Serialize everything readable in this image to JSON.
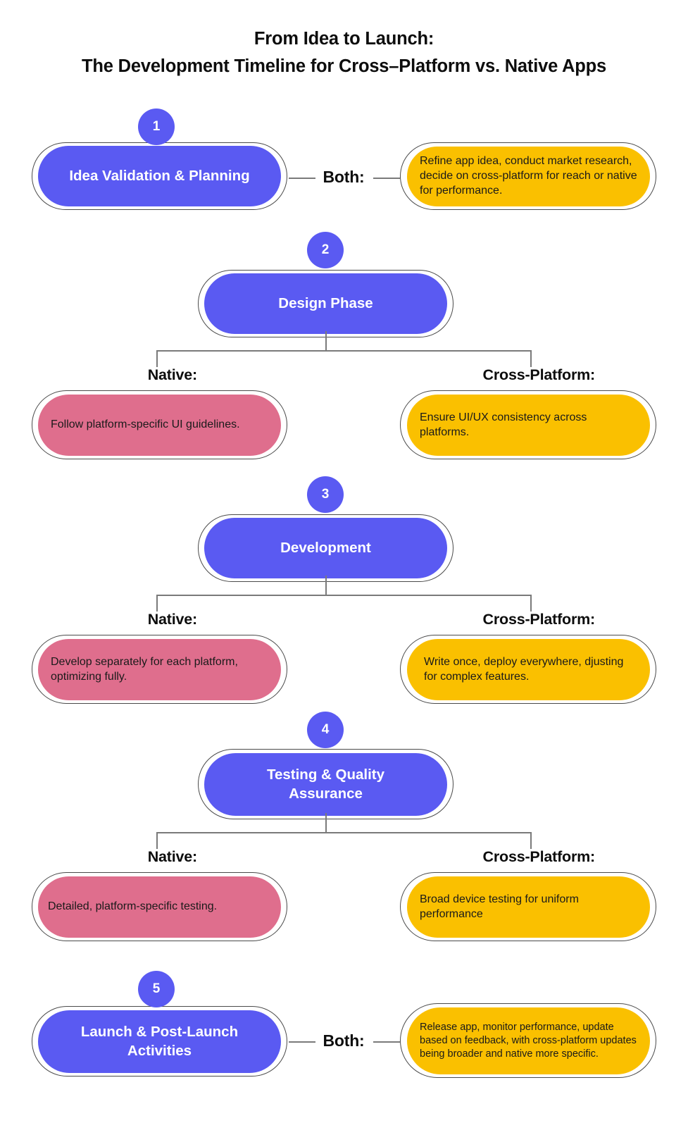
{
  "title": {
    "line1": "From Idea to Launch:",
    "line2": "The Development Timeline for Cross–Platform vs. Native Apps"
  },
  "colors": {
    "blue": "#5a5af2",
    "yellow": "#fac000",
    "pink": "#df6e8d",
    "outline": "#4a4a4a",
    "connector": "#7a7a7a",
    "text_dark": "#0d0d0d",
    "text_light": "#ffffff",
    "background": "#ffffff"
  },
  "labels": {
    "both": "Both:",
    "native": "Native:",
    "cross_platform": "Cross-Platform:"
  },
  "steps": [
    {
      "number": "1",
      "title": "Idea Validation & Planning",
      "layout": "both",
      "both_label": "Both:",
      "both_text": "Refine app idea, conduct market research, decide on cross-platform for reach or native for performance."
    },
    {
      "number": "2",
      "title": "Design Phase",
      "layout": "branch",
      "native_label": "Native:",
      "native_text": "Follow platform-specific UI guidelines.",
      "cross_label": "Cross-Platform:",
      "cross_text": "Ensure UI/UX consistency across platforms."
    },
    {
      "number": "3",
      "title": "Development",
      "layout": "branch",
      "native_label": "Native:",
      "native_text": "Develop separately for each platform, optimizing fully.",
      "cross_label": "Cross-Platform:",
      "cross_text": "Write once, deploy everywhere, djusting for complex features."
    },
    {
      "number": "4",
      "title": "Testing & Quality Assurance",
      "layout": "branch",
      "native_label": "Native:",
      "native_text": "Detailed, platform-specific testing.",
      "cross_label": "Cross-Platform:",
      "cross_text": "Broad device testing for uniform performance"
    },
    {
      "number": "5",
      "title": "Launch & Post-Launch Activities",
      "layout": "both",
      "both_label": "Both:",
      "both_text": "Release app, monitor performance, update based on feedback, with cross-platform updates being broader and native more specific."
    }
  ]
}
